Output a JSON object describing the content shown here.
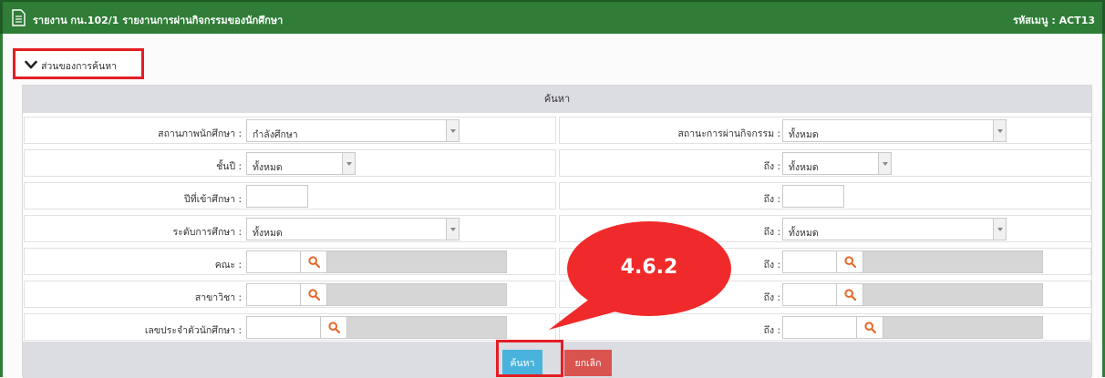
{
  "header": {
    "title": "รายงาน กน.102/1 รายงานการผ่านกิจกรรมของนักศึกษา",
    "menu_code": "รหัสเมนู : ACT13"
  },
  "search_toggle": {
    "label": "ส่วนของการค้นหา",
    "icon": "chevron-down-icon"
  },
  "panel": {
    "heading": "ค้นหา"
  },
  "form": {
    "student_status": {
      "label": "สถานภาพนักศึกษา :",
      "value": "กำลังศึกษา"
    },
    "activity_status": {
      "label": "สถานะการผ่านกิจกรรม :",
      "value": "ทั้งหมด"
    },
    "year_level": {
      "label": "ชั้นปี :",
      "value": "ทั้งหมด"
    },
    "year_level_to": {
      "label": "ถึง :",
      "value": "ทั้งหมด"
    },
    "entry_year": {
      "label": "ปีที่เข้าศึกษา :",
      "value": ""
    },
    "entry_year_to": {
      "label": "ถึง :",
      "value": ""
    },
    "edu_level": {
      "label": "ระดับการศึกษา :",
      "value": "ทั้งหมด"
    },
    "edu_level_to": {
      "label": "ถึง :",
      "value": "ทั้งหมด"
    },
    "faculty": {
      "label": "คณะ :",
      "code": "",
      "description": ""
    },
    "faculty_to": {
      "label": "ถึง :",
      "code": "",
      "description": ""
    },
    "major": {
      "label": "สาขาวิชา :",
      "code": "",
      "description": ""
    },
    "major_to": {
      "label": "ถึง :",
      "code": "",
      "description": ""
    },
    "student_id": {
      "label": "เลขประจำตัวนักศึกษา :",
      "code": "",
      "description": ""
    },
    "student_id_to": {
      "label": "ถึง :",
      "code": "",
      "description": ""
    }
  },
  "buttons": {
    "search": "ค้นหา",
    "cancel": "ยกเลิก"
  },
  "annotation": {
    "label": "4.6.2",
    "color": "#f02a2a"
  },
  "colors": {
    "header": "#2f7d37",
    "highlight": "#e31e24",
    "search_button": "#4ab3dd",
    "cancel_button": "#d9534f",
    "magnifier": "#e8682a"
  }
}
